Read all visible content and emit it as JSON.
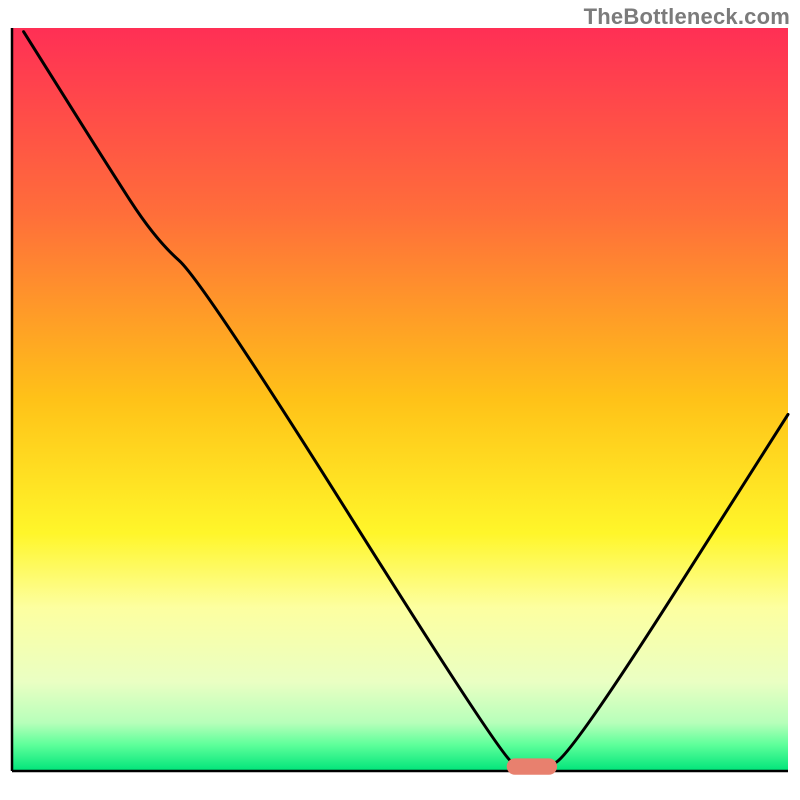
{
  "watermark": "TheBottleneck.com",
  "chart_data": {
    "type": "line",
    "title": "",
    "xlabel": "",
    "ylabel": "",
    "xlim": [
      0,
      100
    ],
    "ylim": [
      0,
      100
    ],
    "grid": false,
    "legend": false,
    "annotations": [],
    "background_gradient_stops": [
      {
        "offset": 0.0,
        "color": "#ff2f55"
      },
      {
        "offset": 0.25,
        "color": "#ff6e3a"
      },
      {
        "offset": 0.5,
        "color": "#ffc218"
      },
      {
        "offset": 0.68,
        "color": "#fff62a"
      },
      {
        "offset": 0.78,
        "color": "#fdffa0"
      },
      {
        "offset": 0.88,
        "color": "#eaffc3"
      },
      {
        "offset": 0.935,
        "color": "#b7ffba"
      },
      {
        "offset": 0.965,
        "color": "#5dff9a"
      },
      {
        "offset": 1.0,
        "color": "#00e47a"
      }
    ],
    "series": [
      {
        "name": "bottleneck-curve",
        "x": [
          1.5,
          12,
          18.5,
          24.5,
          63,
          66,
          68,
          72,
          100
        ],
        "y": [
          99.5,
          82,
          71.5,
          66,
          2,
          0.2,
          0.2,
          2,
          48
        ],
        "comment": "y is percent height from bottom axis; curve drops from top-left, has a wide flat minimum around x≈65–70, then rises to the right edge."
      }
    ],
    "marker": {
      "name": "optimal-zone-marker",
      "x_center": 67,
      "y_center": 0.6,
      "width": 6.5,
      "height": 2.2,
      "color": "#e8806e"
    }
  }
}
